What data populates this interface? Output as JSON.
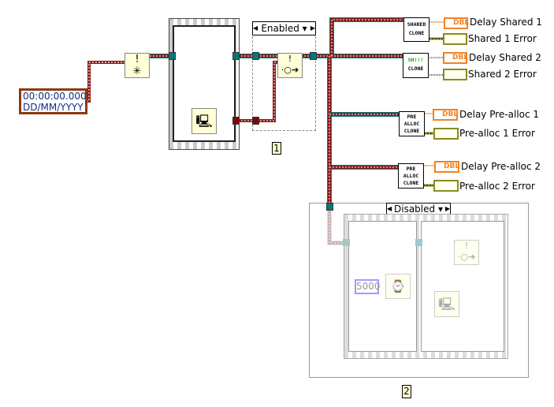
{
  "timestamp_constant": {
    "time": "00:00:00.000",
    "date": "DD/MM/YYYY"
  },
  "structures": {
    "enabled_selector": "Enabled",
    "disabled_selector": "Disabled",
    "label_1": "1",
    "label_2": "2"
  },
  "subvis": [
    {
      "line1": "SHARED",
      "line2": "CLONE"
    },
    {
      "line1": "SH!!!",
      "line2": "CLONE"
    },
    {
      "line1": "PRE",
      "line2": "ALLOC",
      "line3": "CLONE"
    },
    {
      "line1": "PRE",
      "line2": "ALLOC",
      "line3": "CLONE"
    }
  ],
  "indicators": [
    {
      "type": "DBL",
      "label": "Delay Shared 1"
    },
    {
      "type": "error",
      "label": "Shared 1 Error"
    },
    {
      "type": "DBL",
      "label": "Delay Shared 2"
    },
    {
      "type": "error",
      "label": "Shared 2 Error"
    },
    {
      "type": "DBL",
      "label": "Delay Pre-alloc 1"
    },
    {
      "type": "error",
      "label": "Pre-alloc 1 Error"
    },
    {
      "type": "DBL",
      "label": "Delay Pre-alloc 2"
    },
    {
      "type": "error",
      "label": "Pre-alloc 2 Error"
    }
  ],
  "wait_constant": "5000",
  "icons": [
    "clear-errors-icon",
    "tick-count-icon",
    "merge-errors-icon",
    "wait-ms-icon"
  ],
  "colors": {
    "error_wire": "#8b0000",
    "refnum_wire": "#007b7b",
    "dbl": "#f58220",
    "error_cluster": "#8a8a20"
  }
}
